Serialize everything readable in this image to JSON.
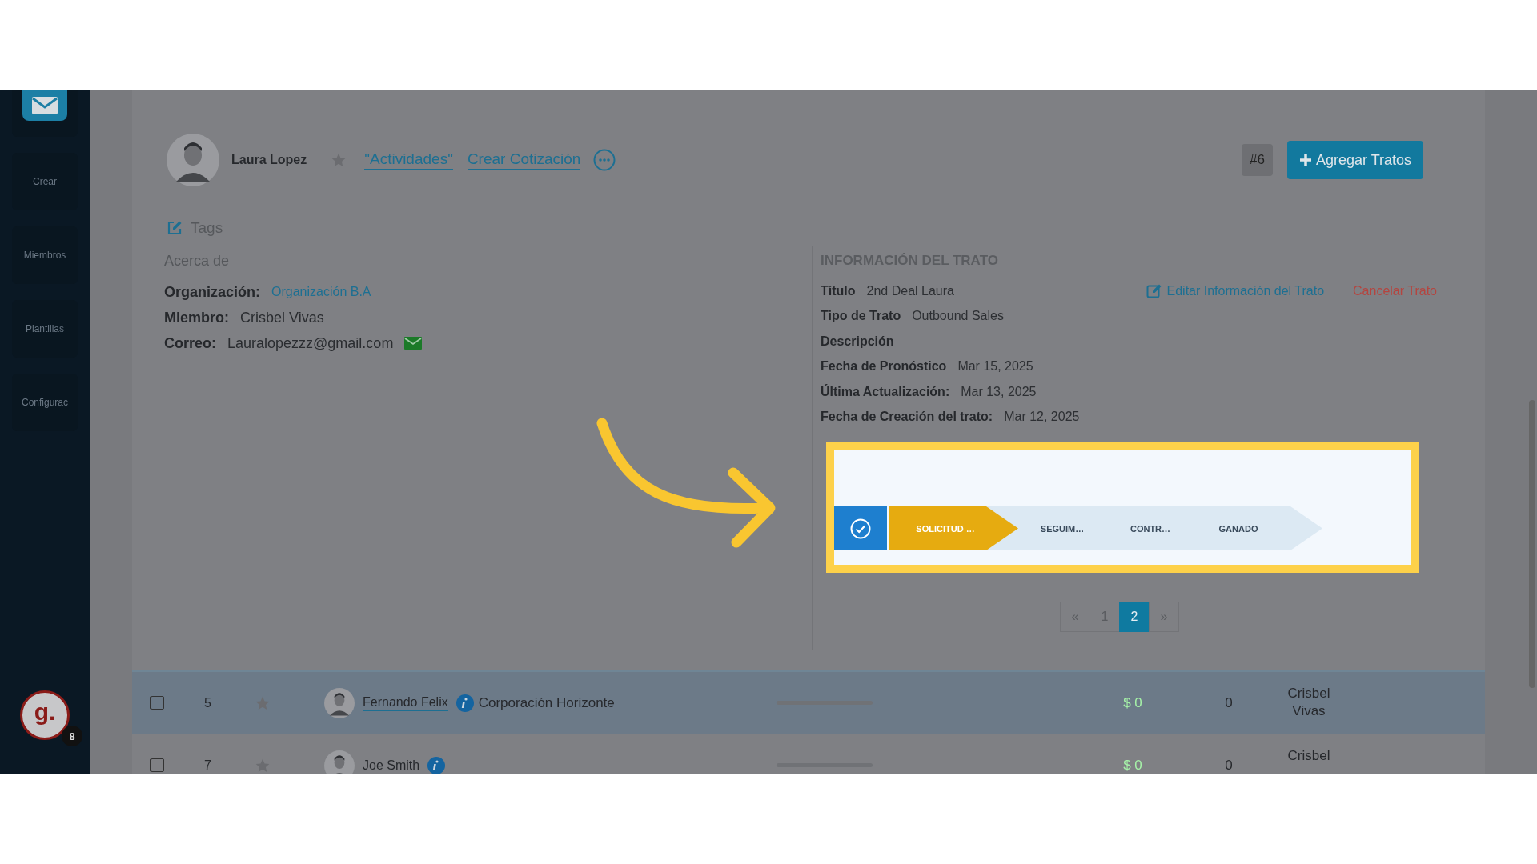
{
  "sidebar": {
    "items": [
      {
        "label": "Crear"
      },
      {
        "label": "Miembros"
      },
      {
        "label": "Plantillas"
      },
      {
        "label": "Configurac"
      }
    ],
    "account": {
      "initial": "g.",
      "badge": "8"
    }
  },
  "contact": {
    "name": "Laura Lopez",
    "starred": false,
    "links": [
      "\"Actividades\"",
      "Crear Cotización"
    ]
  },
  "deal_number": "#6",
  "add_button": "Agregar Tratos",
  "tags_label": "Tags",
  "about": {
    "heading": "Acerca de",
    "fields": [
      {
        "label": "Organización:",
        "value": "Organización B.A",
        "kind": "link"
      },
      {
        "label": "Miembro:",
        "value": "Crisbel Vivas",
        "kind": "text"
      },
      {
        "label": "Correo:",
        "value": "Lauralopezzz@gmail.com",
        "kind": "email"
      }
    ]
  },
  "deal_info": {
    "heading": "INFORMACIÓN DEL TRATO",
    "edit_link": "Editar Información del Trato",
    "cancel_link": "Cancelar Trato",
    "fields": [
      {
        "label": "Título",
        "value": "2nd Deal Laura"
      },
      {
        "label": "Tipo de Trato",
        "value": "Outbound Sales"
      },
      {
        "label": "Descripción"
      },
      {
        "label": "Fecha de Pronóstico",
        "value": "Mar 15, 2025"
      },
      {
        "label": "Última Actualización:",
        "value": "Mar 13, 2025"
      },
      {
        "label": "Fecha de Creación del trato:",
        "value": "Mar 12, 2025"
      }
    ]
  },
  "pipeline": {
    "stages": [
      {
        "label": "SOLICITUD …",
        "selected": true
      },
      {
        "label": "SEGUIM…",
        "selected": false
      },
      {
        "label": "CONTR…",
        "selected": false
      },
      {
        "label": "GANADO",
        "selected": false
      }
    ]
  },
  "pagination": [
    {
      "label": "«",
      "selected": false
    },
    {
      "label": "1",
      "selected": false
    },
    {
      "label": "2",
      "selected": true
    },
    {
      "label": "»",
      "selected": false
    }
  ],
  "rows": [
    {
      "selected": true,
      "checked": false,
      "number": "5",
      "starred": false,
      "name": "Fernando Felix",
      "company": "Corporación Horizonte",
      "amount": "$ 0",
      "count": "0",
      "member": [
        "Crisbel",
        "Vivas"
      ]
    },
    {
      "selected": false,
      "checked": false,
      "number": "7",
      "starred": false,
      "name": "Joe Smith",
      "amount": "$ 0",
      "count": "0",
      "member": [
        "Crisbel"
      ]
    }
  ]
}
